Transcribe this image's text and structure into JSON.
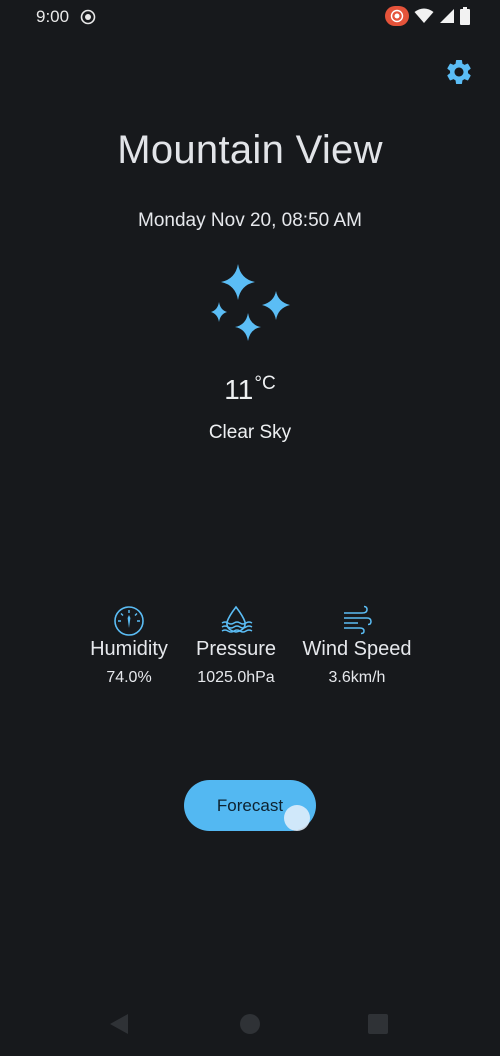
{
  "status_bar": {
    "time": "9:00",
    "icons": [
      "notification-dot-icon",
      "screen-record-icon",
      "wifi-icon",
      "cellular-signal-icon",
      "battery-icon"
    ],
    "record_badge_color": "#e5533a"
  },
  "header": {
    "settings_icon": "gear-icon"
  },
  "weather": {
    "city": "Mountain View",
    "datetime": "Monday Nov 20, 08:50 AM",
    "icon": "clear-sky-sparkles-icon",
    "temperature": "11",
    "temperature_unit": "°C",
    "condition": "Clear Sky"
  },
  "metrics": [
    {
      "icon": "gauge-icon",
      "label": "Humidity",
      "value": "74.0%"
    },
    {
      "icon": "water-drop-waves-icon",
      "label": "Pressure",
      "value": "1025.0hPa"
    },
    {
      "icon": "wind-icon",
      "label": "Wind Speed",
      "value": "3.6km/h"
    }
  ],
  "forecast_button": {
    "label": "Forecast"
  },
  "nav_bar": {
    "icons": [
      "back-icon",
      "home-icon",
      "recents-icon"
    ]
  },
  "colors": {
    "background": "#17191c",
    "accent": "#53b8f2",
    "icon_blue": "#5bbdf5",
    "text": "#e6e8ec"
  }
}
